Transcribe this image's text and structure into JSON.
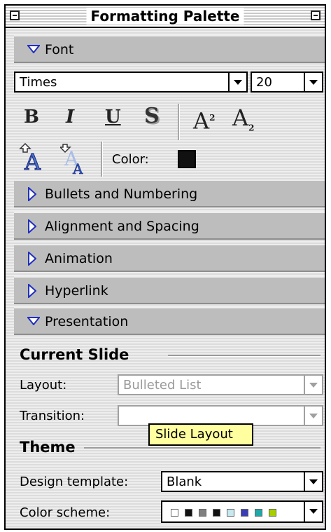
{
  "window": {
    "title": "Formatting Palette"
  },
  "sections": {
    "font": {
      "label": "Font",
      "expanded": true
    },
    "bullets": {
      "label": "Bullets and Numbering",
      "expanded": false
    },
    "alignment": {
      "label": "Alignment and Spacing",
      "expanded": false
    },
    "animation": {
      "label": "Animation",
      "expanded": false
    },
    "hyperlink": {
      "label": "Hyperlink",
      "expanded": false
    },
    "presentation": {
      "label": "Presentation",
      "expanded": true
    }
  },
  "font": {
    "name": "Times",
    "size": "20",
    "bold": "B",
    "italic": "I",
    "underline": "U",
    "shadow": "S",
    "superscript_base": "A",
    "superscript_mark": "2",
    "subscript_base": "A",
    "subscript_mark": "2",
    "color_label": "Color:",
    "color_value": "#111111"
  },
  "presentation": {
    "current_slide_heading": "Current Slide",
    "layout_label": "Layout:",
    "layout_value": "Bulleted List",
    "transition_label": "Transition:",
    "transition_value": "",
    "theme_heading": "Theme",
    "design_template_label": "Design template:",
    "design_template_value": "Blank",
    "color_scheme_label": "Color scheme:",
    "color_scheme_swatches": [
      "#ffffff",
      "#111111",
      "#808080",
      "#111111",
      "#c8e8f0",
      "#3c3cb4",
      "#20a8a8",
      "#a8d000"
    ]
  },
  "tooltip": {
    "text": "Slide Layout"
  }
}
